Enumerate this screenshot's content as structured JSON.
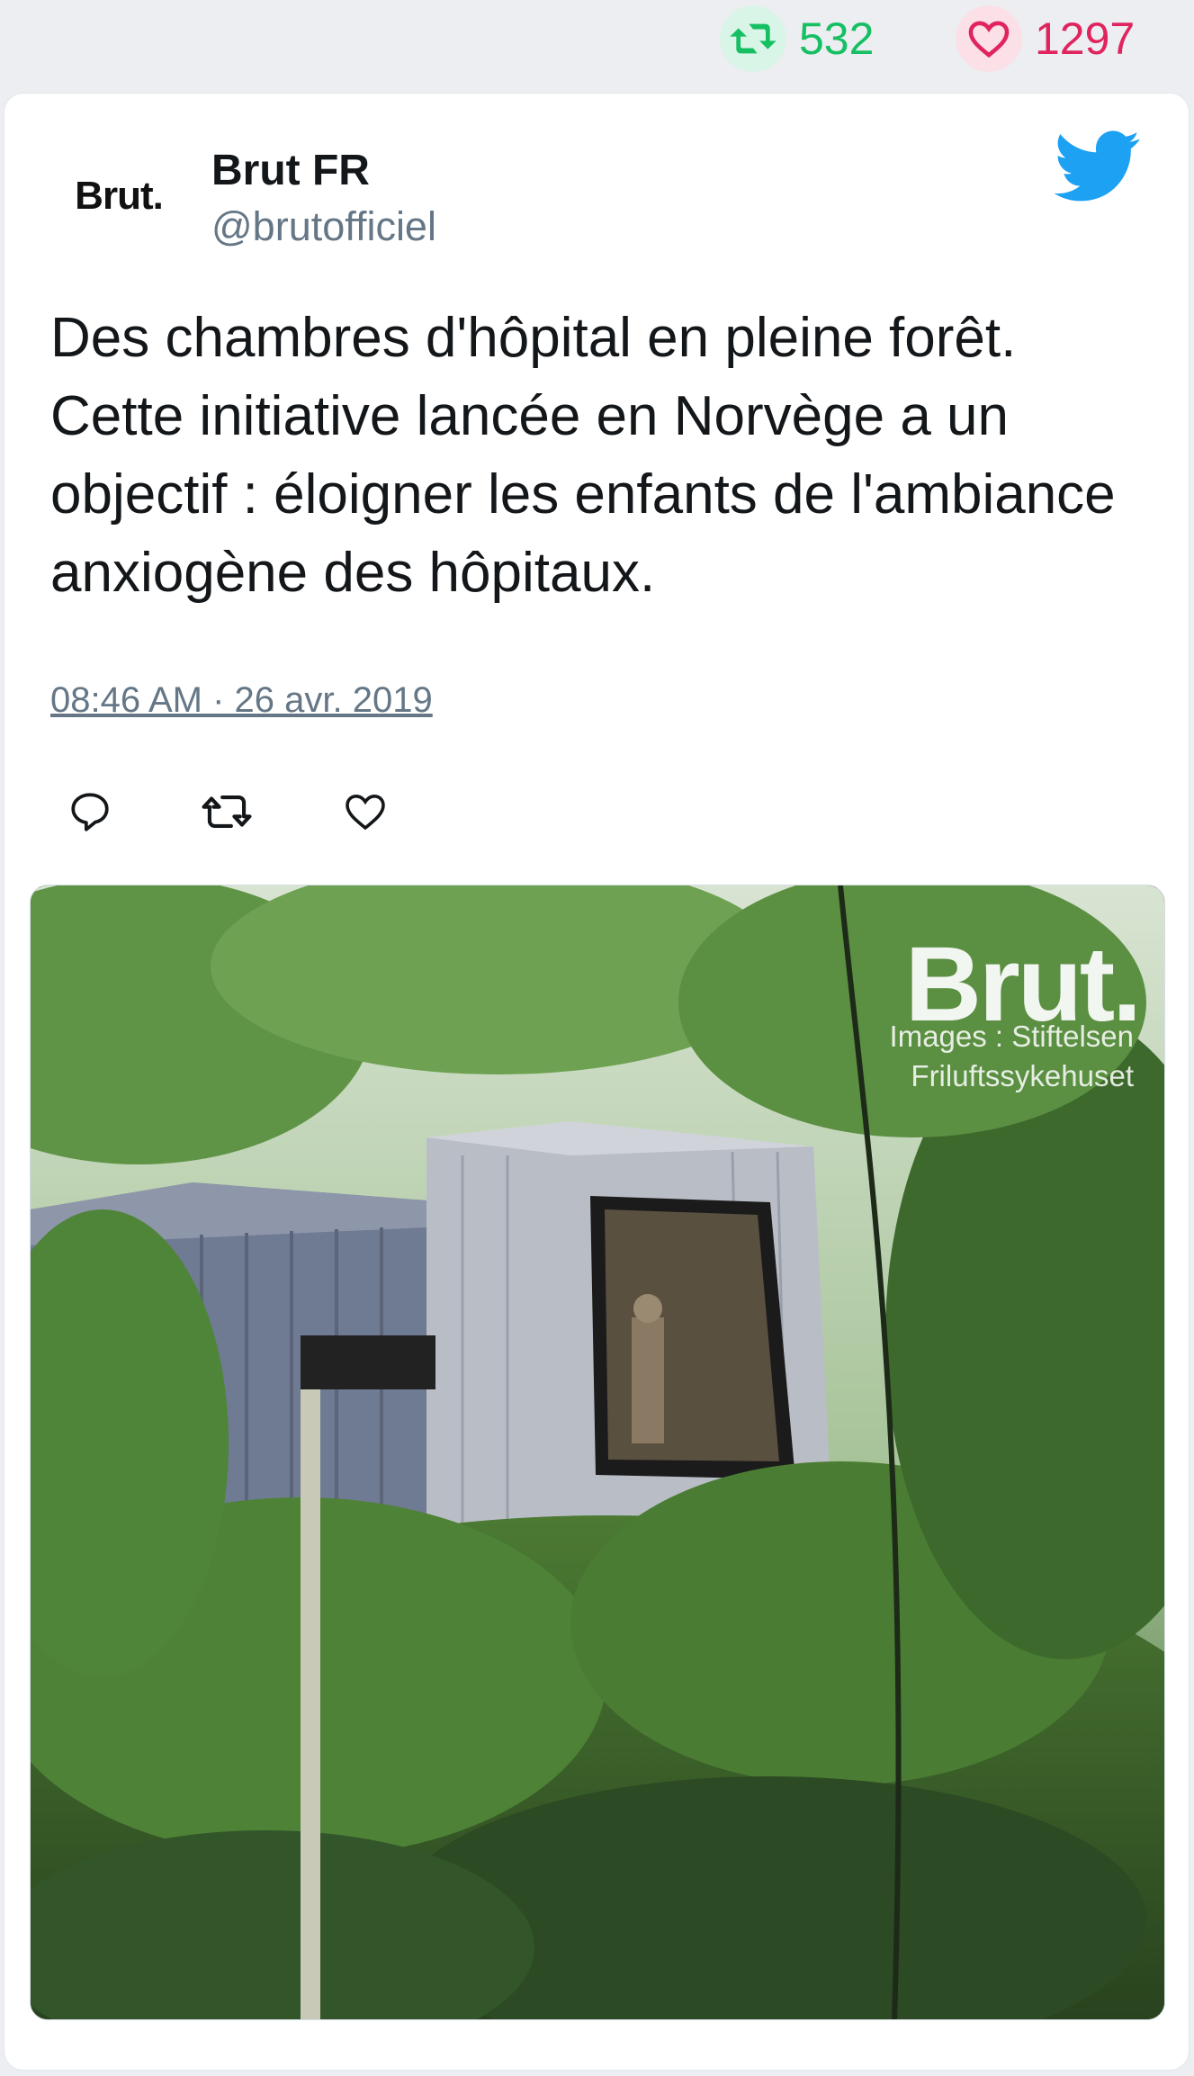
{
  "stats": {
    "retweets": "532",
    "likes": "1297"
  },
  "tweet": {
    "display_name": "Brut FR",
    "handle": "@brutofficiel",
    "avatar_text": "Brut.",
    "text": "Des chambres d'hôpital en pleine forêt. Cette initiative lancée en Norvège a un objectif : éloigner les enfants de l'ambiance anxiogène des hôpitaux.",
    "timestamp": "08:46 AM · 26 avr. 2019"
  },
  "media": {
    "watermark_brand": "Brut.",
    "watermark_credit": "Images : Stiftelsen Friluftssykehuset"
  },
  "colors": {
    "retweet_green": "#17bf63",
    "like_red": "#e0245e",
    "twitter_blue": "#1da1f2",
    "muted_gray": "#657786"
  },
  "icons": {
    "retweet": "retweet-icon",
    "like": "heart-icon",
    "reply": "reply-icon",
    "brand": "twitter-bird-icon"
  }
}
